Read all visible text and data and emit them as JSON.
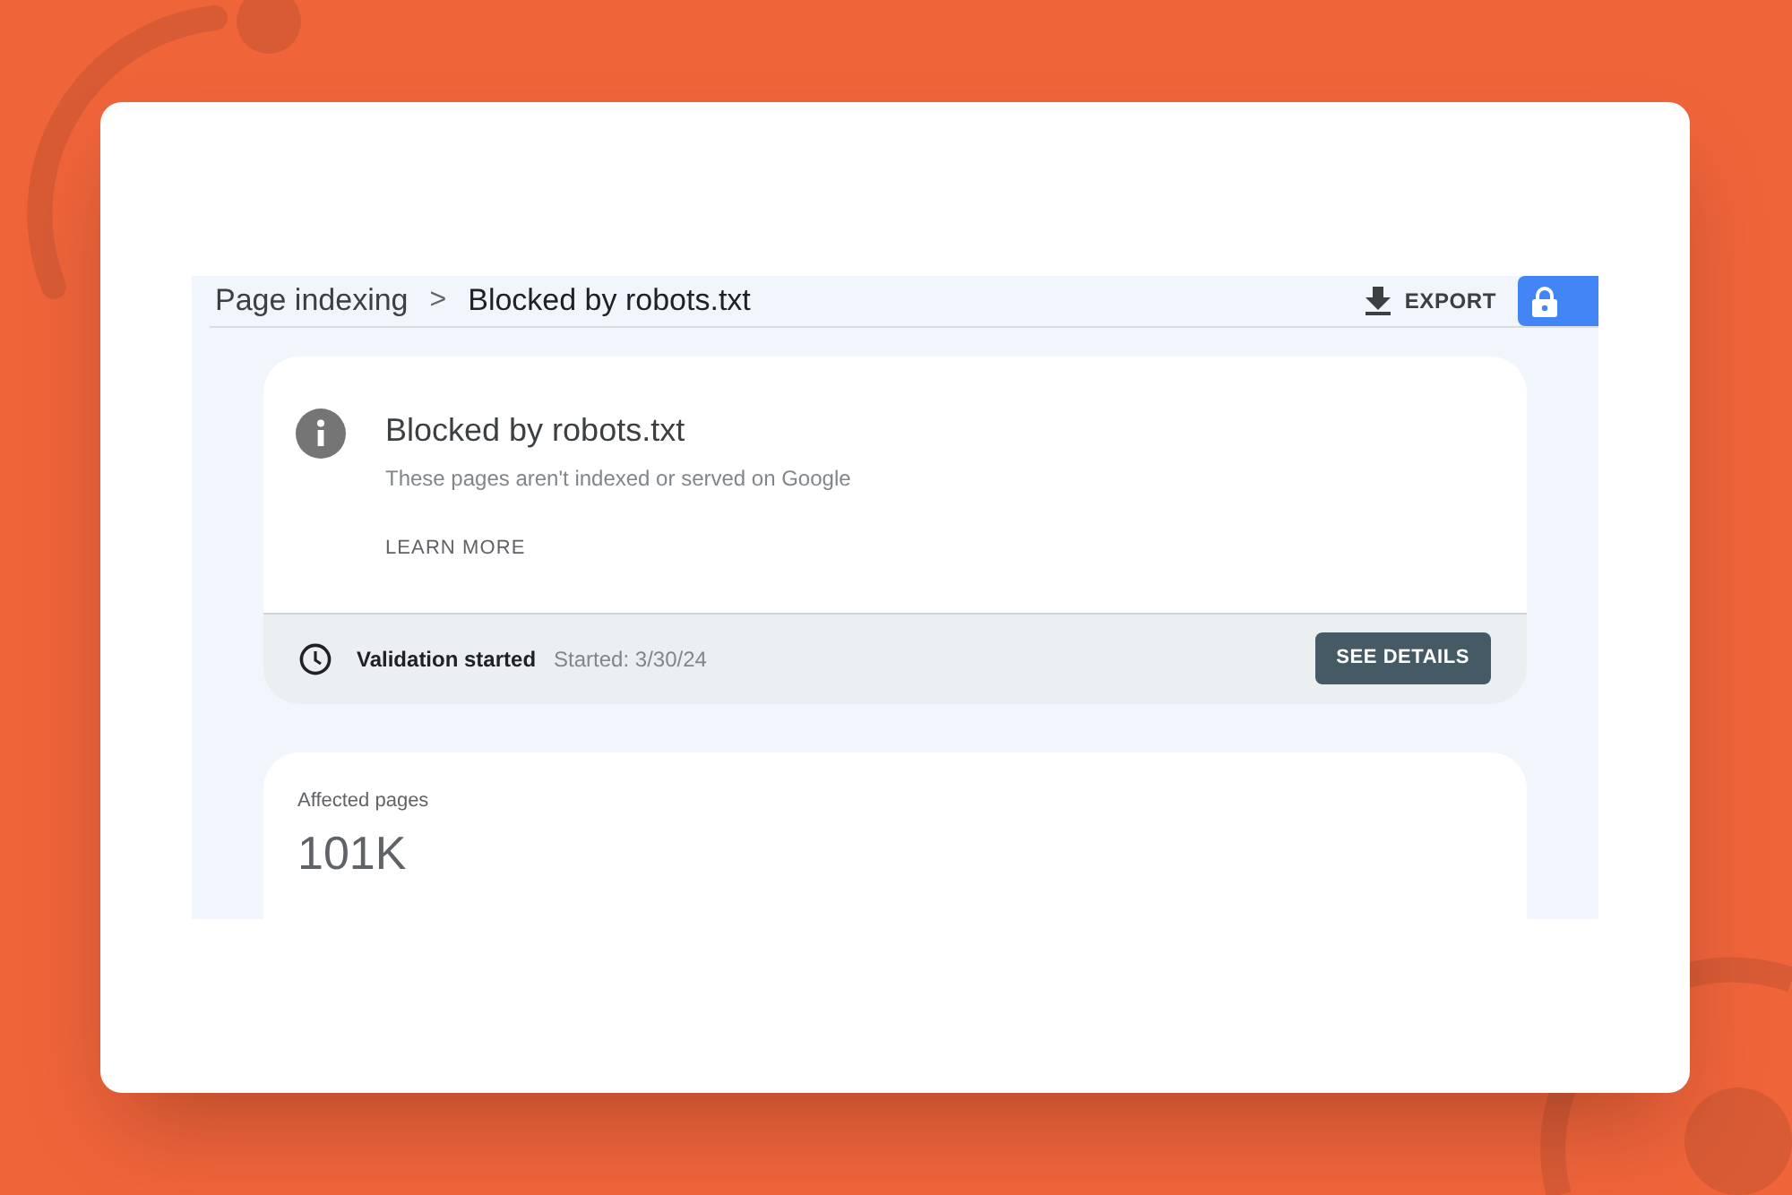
{
  "breadcrumb": {
    "parent": "Page indexing",
    "separator": ">",
    "current": "Blocked by robots.txt"
  },
  "toolbar": {
    "export": "EXPORT"
  },
  "issue": {
    "title": "Blocked by robots.txt",
    "description": "These pages aren't indexed or served on Google",
    "learn_more": "LEARN MORE"
  },
  "validation": {
    "status": "Validation started",
    "started": "Started: 3/30/24",
    "button": "SEE DETAILS"
  },
  "summary": {
    "label": "Affected pages",
    "value": "101K"
  }
}
